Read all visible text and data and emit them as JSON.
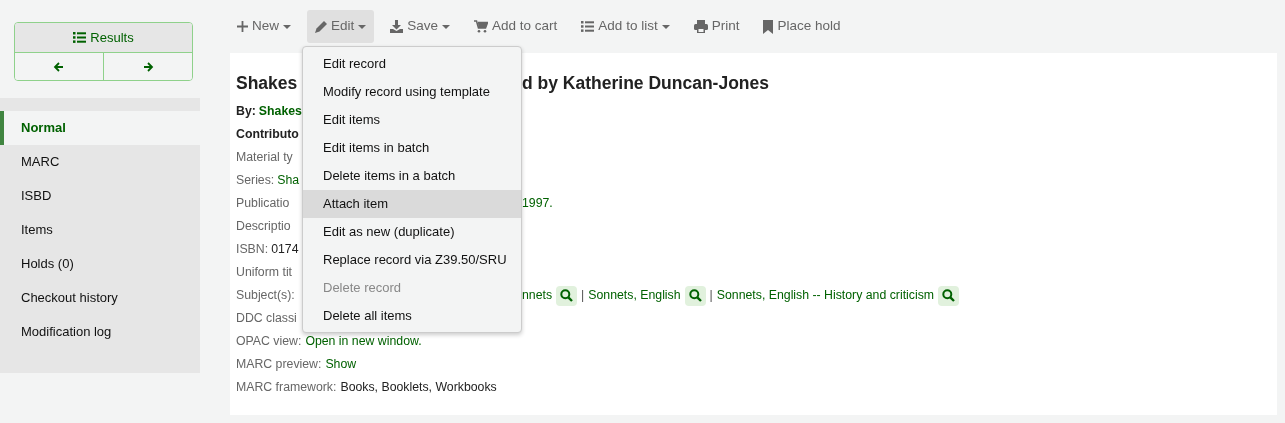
{
  "results_box": {
    "label": "Results"
  },
  "sidebar": {
    "items": [
      {
        "label": "Normal",
        "selected": true
      },
      {
        "label": "MARC",
        "selected": false
      },
      {
        "label": "ISBD",
        "selected": false
      },
      {
        "label": "Items",
        "selected": false
      },
      {
        "label": "Holds (0)",
        "selected": false
      },
      {
        "label": "Checkout history",
        "selected": false
      },
      {
        "label": "Modification log",
        "selected": false
      }
    ]
  },
  "toolbar": [
    {
      "label": "New",
      "caret": true,
      "selected": false
    },
    {
      "label": "Edit",
      "caret": true,
      "selected": true
    },
    {
      "label": "Save",
      "caret": true,
      "selected": false
    },
    {
      "label": "Add to cart",
      "caret": false,
      "selected": false
    },
    {
      "label": "Add to list",
      "caret": true,
      "selected": false
    },
    {
      "label": "Print",
      "caret": false,
      "selected": false
    },
    {
      "label": "Place hold",
      "caret": false,
      "selected": false
    }
  ],
  "edit_menu": [
    {
      "label": "Edit record",
      "selected": false,
      "disabled": false
    },
    {
      "label": "Modify record using template",
      "selected": false,
      "disabled": false
    },
    {
      "label": "Edit items",
      "selected": false,
      "disabled": false
    },
    {
      "label": "Edit items in batch",
      "selected": false,
      "disabled": false
    },
    {
      "label": "Delete items in a batch",
      "selected": false,
      "disabled": false
    },
    {
      "label": "Attach item",
      "selected": true,
      "disabled": false
    },
    {
      "label": "Edit as new (duplicate)",
      "selected": false,
      "disabled": false
    },
    {
      "label": "Replace record via Z39.50/SRU",
      "selected": false,
      "disabled": false
    },
    {
      "label": "Delete record",
      "selected": false,
      "disabled": true
    },
    {
      "label": "Delete all items",
      "selected": false,
      "disabled": false
    }
  ],
  "record": {
    "title_left": "Shakes",
    "title_right": "d by Katherine Duncan-Jones",
    "lines": [
      {
        "left": [
          {
            "kind": "label",
            "text": "By:"
          },
          {
            "kind": "link",
            "text": "Shakes"
          }
        ]
      },
      {
        "left": [
          {
            "kind": "label",
            "text": "Contributo"
          }
        ]
      },
      {
        "left": [
          {
            "kind": "text",
            "text": "Material ty"
          }
        ]
      },
      {
        "left": [
          {
            "kind": "text",
            "text": "Series:"
          },
          {
            "kind": "link",
            "text": "Sha"
          }
        ]
      },
      {
        "left": [
          {
            "kind": "text",
            "text": "Publicatio"
          }
        ],
        "right": [
          {
            "kind": "link",
            "text": "1997."
          }
        ]
      },
      {
        "left": [
          {
            "kind": "text",
            "text": "Descriptio"
          }
        ]
      },
      {
        "left": [
          {
            "kind": "text",
            "text": "ISBN:"
          },
          {
            "kind": "value",
            "text": "0174"
          }
        ]
      },
      {
        "left": [
          {
            "kind": "text",
            "text": "Uniform tit"
          }
        ]
      },
      {
        "left": [
          {
            "kind": "text",
            "text": "Subject(s):"
          }
        ],
        "right": [
          {
            "kind": "link",
            "text": "nnets"
          },
          {
            "kind": "search"
          },
          {
            "kind": "sep",
            "text": "|"
          },
          {
            "kind": "link",
            "text": "Sonnets, English"
          },
          {
            "kind": "search"
          },
          {
            "kind": "sep",
            "text": "|"
          },
          {
            "kind": "link",
            "text": "Sonnets, English -- History and criticism"
          },
          {
            "kind": "search"
          }
        ]
      },
      {
        "left": [
          {
            "kind": "text",
            "text": "DDC classi"
          }
        ]
      },
      {
        "full": [
          {
            "kind": "text",
            "text": "OPAC view:"
          },
          {
            "kind": "link",
            "text": "Open in new window."
          }
        ]
      },
      {
        "full": [
          {
            "kind": "text",
            "text": "MARC preview:"
          },
          {
            "kind": "link",
            "text": "Show"
          }
        ]
      },
      {
        "full": [
          {
            "kind": "text",
            "text": "MARC framework:"
          },
          {
            "kind": "value",
            "text": "Books, Booklets, Workbooks"
          }
        ]
      }
    ]
  }
}
